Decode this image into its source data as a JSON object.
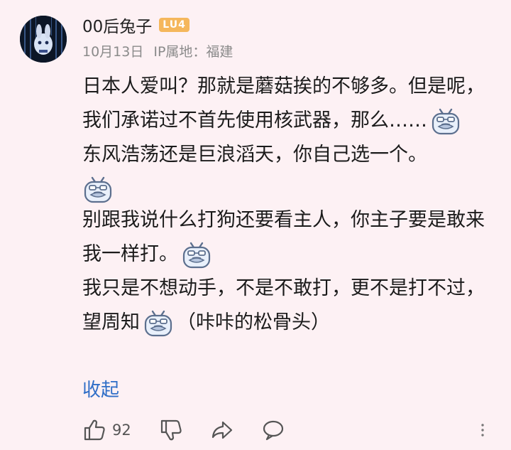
{
  "comment": {
    "username": "00后兔子",
    "level_badge": "LU4",
    "date": "10月13日",
    "ip_location": "IP属地：福建",
    "paragraphs": [
      "日本人爱叫？那就是蘑菇挨的不够多。但是呢，我们承诺过不首先使用核武器，那么……",
      "东风浩荡还是巨浪滔天，你自己选一个。",
      "别跟我说什么打狗还要看主人，你主子要是敢来我一样打。",
      "我只是不想动手，不是不敢打，更不是打不过，望周知",
      "（咔咔的松骨头）"
    ],
    "collapse_label": "收起",
    "like_count": "92"
  },
  "colors": {
    "background": "#fdf1f4",
    "link": "#2f6ec7",
    "level_badge": "#f5b75c"
  },
  "icons": {
    "avatar": "avatar-anime-character",
    "emoji": "bilibili-tv-mascot-emoji",
    "like": "thumb-up-icon",
    "dislike": "thumb-down-icon",
    "share": "share-arrow-icon",
    "reply": "speech-bubble-icon",
    "more": "more-vertical-icon"
  }
}
